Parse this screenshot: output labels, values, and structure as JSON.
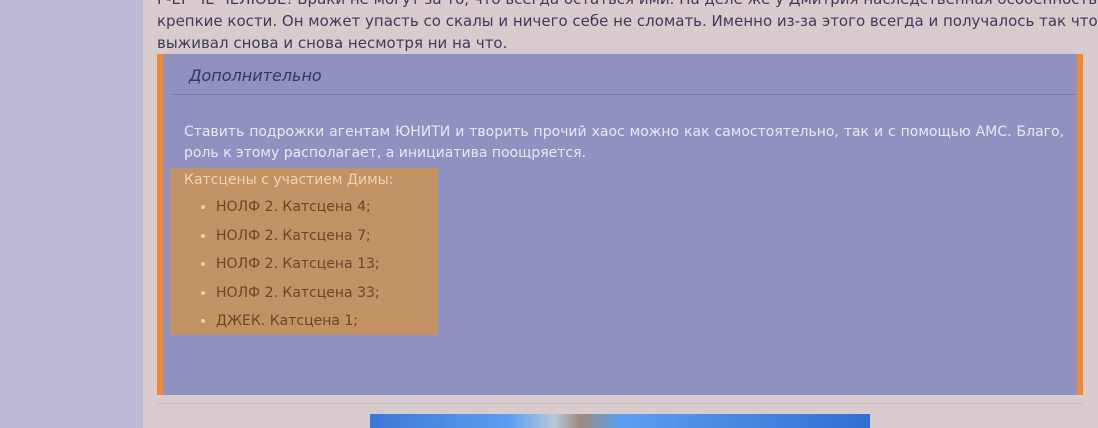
{
  "intro": {
    "line1": "Г-ЕГ ЧЕ ЧЕЛЮВЕ! Браки не могут за то, что всегда остаться ими. На деле же у Дмитрия наследственная особенность это",
    "line2": "крепкие кости. Он может упасть со скалы и ничего себе не сломать. Именно из-за этого всегда и получалось так что Волков",
    "line3": "выживал снова и снова несмотря ни на что."
  },
  "panel": {
    "title": "Дополнительно",
    "text": "Ставить подрожки агентам ЮНИТИ и творить прочий хаос можно как самостоятельно, так и с помощью АМС. Благо, роль к этому располагает, а инициатива поощряется."
  },
  "cutscenes": {
    "title": "Катсцены с участием Димы:",
    "items": [
      "НОЛФ 2. Катсцена 4;",
      "НОЛФ 2. Катсцена 7;",
      "НОЛФ 2. Катсцена 13;",
      "НОЛФ 2. Катсцена 33;",
      "ДЖЕК. Катсцена 1;"
    ]
  },
  "colors": {
    "panel_bg": "#8f91c1",
    "accent_border": "#f0892f",
    "cutscene_bg": "#c29265",
    "page_bg": "#d8cbcd",
    "side_bg": "#bdb8d6"
  }
}
